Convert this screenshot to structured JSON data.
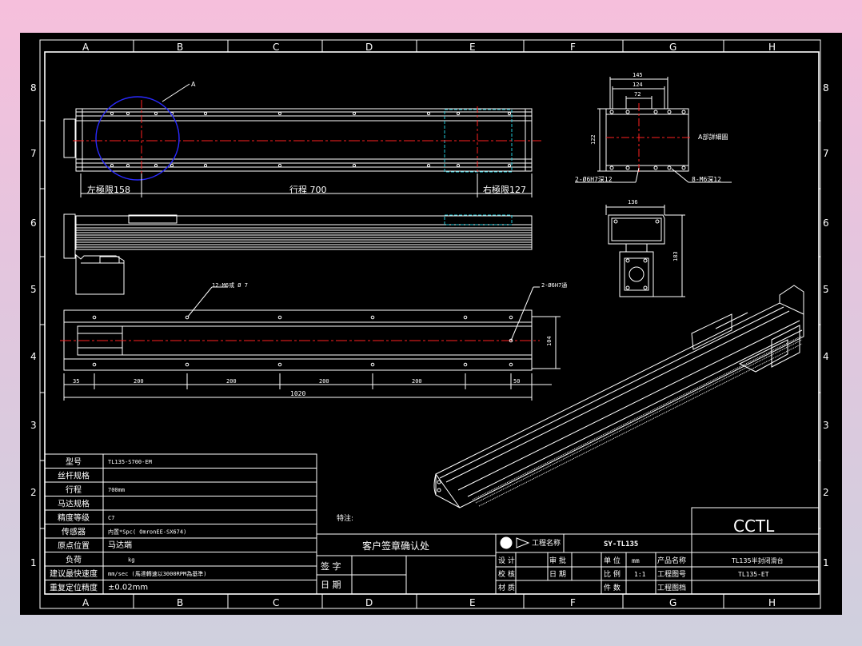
{
  "colors": {
    "background": "#000000",
    "line": "#ffffff",
    "centerline": "#ff2020",
    "circle": "#2a2aff",
    "hidden": "#20c8d8"
  },
  "border": {
    "columns": [
      "A",
      "B",
      "C",
      "D",
      "E",
      "F",
      "G",
      "H"
    ],
    "rows": [
      "8",
      "7",
      "6",
      "5",
      "4",
      "3",
      "2",
      "1"
    ]
  },
  "top_view": {
    "circle_label": "A",
    "left_limit": "左極限158",
    "stroke": "行程 700",
    "right_limit": "右極限127"
  },
  "front_view": {
    "hole_note_left": "12-M6或 Ø 7",
    "hole_note_right": "2-Ø6H7通",
    "height_dim": "104",
    "dims": [
      "35",
      "200",
      "200",
      "200",
      "200",
      "50"
    ],
    "total_length": "1020"
  },
  "detail_view": {
    "dims": [
      "145",
      "124",
      "72"
    ],
    "side_dim": "122",
    "label": "A部詳細圖",
    "note_left": "2-Ø6H7深12",
    "note_right": "8-M6深12"
  },
  "end_view": {
    "width_dim": "136",
    "height_dim": "183"
  },
  "spec_table": [
    {
      "label": "型号",
      "value": "TL135-S700-EM"
    },
    {
      "label": "丝杆规格",
      "value": ""
    },
    {
      "label": "行程",
      "value": "700mm"
    },
    {
      "label": "马达规格",
      "value": ""
    },
    {
      "label": "精度等级",
      "value": "C7"
    },
    {
      "label": "传感器",
      "value": "内置*Spc( OmronEE-SX674)"
    },
    {
      "label": "原点位置",
      "value": "马达端"
    },
    {
      "label": "负荷",
      "value": "kg"
    },
    {
      "label": "建议最快速度",
      "value": "mm/sec (馬達轉速以3000RPM為基準)"
    },
    {
      "label": "重复定位精度",
      "value": "±0.02mm"
    }
  ],
  "special_note": "特注:",
  "customer_box": {
    "title": "客户签章确认处",
    "sign": "签 字",
    "date": "日 期"
  },
  "title_block": {
    "company": "CCTL",
    "engineer_name_label": "工程名称",
    "drawing_no": "SY-TL135",
    "design": "设 计",
    "review": "审 批",
    "check": "校 核",
    "date": "日 期",
    "material": "材 质",
    "unit": "单 位",
    "unit_value": "mm",
    "scale": "比 例",
    "scale_value": "1:1",
    "quantity": "件 数",
    "product_name_label": "产品名称",
    "product_name": "TL135半封闭滑台",
    "drawing_label": "工程图号",
    "drawing_value": "TL135-ET",
    "archive_label": "工程图档"
  }
}
